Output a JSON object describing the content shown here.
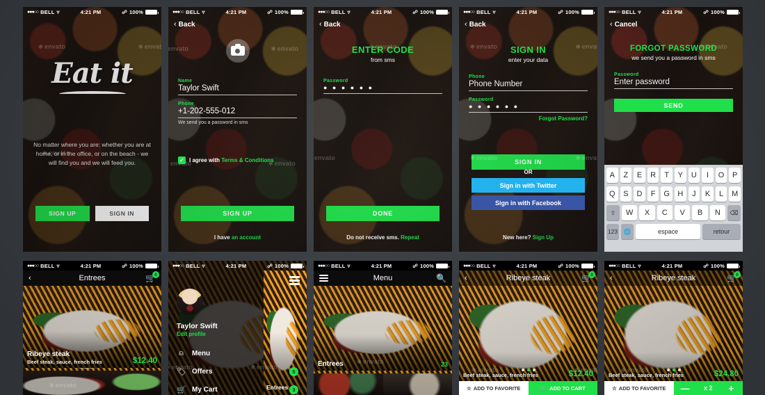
{
  "meta": {
    "background_color": "#3c4146",
    "accent_green": "#1fe04a"
  },
  "statusbar": {
    "carrier": "BELL",
    "dots": "●●●○○",
    "wifi_icon": "wifi-icon",
    "time": "4:21 PM",
    "bluetooth_icon": "bluetooth-icon",
    "battery": "100%"
  },
  "screens": {
    "welcome": {
      "logo": "Eat it",
      "tagline": "No matter where you are: whether you are at home, or in the office, or on the beach - we will find you and we will feed you.",
      "sign_up": "SIGN UP",
      "sign_in": "SIGN IN",
      "watermark": "envato"
    },
    "signup": {
      "back": "Back",
      "camera_icon": "camera-icon",
      "name_label": "Name",
      "name_value": "Taylor Swift",
      "phone_label": "Phone",
      "phone_value": "+1-202-555-012",
      "sms_hint": "We send you a password in sms",
      "agree_prefix": "I agree with ",
      "agree_link": "Terms & Conditions",
      "checkbox_icon": "check-icon",
      "submit": "SIGN UP",
      "footer_prefix": "I have ",
      "footer_link": "an account",
      "watermark": "envato"
    },
    "enter_code": {
      "back": "Back",
      "title": "ENTER CODE",
      "subtitle": "from sms",
      "password_label": "Password",
      "password_value": "● ● ● ● ● ●",
      "submit": "DONE",
      "footer_prefix": "Do not receive sms. ",
      "footer_link": "Repeat",
      "watermark": "envato"
    },
    "signin": {
      "back": "Back",
      "title": "SIGN IN",
      "subtitle": "enter your data",
      "phone_label": "Phone",
      "phone_placeholder": "Phone Number",
      "password_label": "Password",
      "password_value": "● ● ● ● ● ●",
      "forgot": "Forgot Password?",
      "submit": "SIGN IN",
      "or": "OR",
      "twitter": "Sign in with Twitter",
      "facebook": "Sign in with Facebook",
      "footer_prefix": "New here? ",
      "footer_link": "Sign Up",
      "watermark": "envato"
    },
    "forgot_password": {
      "cancel": "Cancel",
      "title": "FORGOT PASSWORD",
      "subtitle": "we send you a password in sms",
      "password_label": "Password",
      "password_placeholder": "Enter password",
      "submit": "SEND",
      "watermark": "envato",
      "keyboard": {
        "layout": "AZERTY",
        "row1": [
          "A",
          "Z",
          "E",
          "R",
          "T",
          "Y",
          "U",
          "I",
          "O",
          "P"
        ],
        "row2": [
          "Q",
          "S",
          "D",
          "F",
          "G",
          "H",
          "J",
          "K",
          "L",
          "M"
        ],
        "row3_letters": [
          "W",
          "X",
          "C",
          "V",
          "B",
          "N"
        ],
        "shift_icon": "shift-icon",
        "backspace_icon": "backspace-icon",
        "numeric": "123",
        "globe_icon": "globe-icon",
        "space": "espace",
        "return": "retour"
      }
    },
    "entrees": {
      "back_icon": "chevron-left-icon",
      "title": "Entrees",
      "cart_icon": "cart-icon",
      "cart_badge": "0",
      "item": {
        "name": "Ribeye steak",
        "desc": "Beef steak, sauce, french fries",
        "price": "$12.40"
      },
      "watermark": "envato"
    },
    "drawer": {
      "hamburger_icon": "hamburger-icon",
      "avatar": "avatar",
      "user_name": "Taylor Swift",
      "edit_profile": "Edit profile",
      "items": [
        {
          "label": "Menu",
          "icon": "dish-cover-icon",
          "badge": ""
        },
        {
          "label": "Offers",
          "icon": "tag-icon",
          "badge": "5"
        },
        {
          "label": "My Cart",
          "icon": "cart-icon",
          "badge": "3"
        }
      ],
      "peek_label": "Entrees",
      "watermark": "envato"
    },
    "menu": {
      "hamburger_icon": "hamburger-icon",
      "title": "Menu",
      "search_icon": "search-icon",
      "category": {
        "name": "Entrees",
        "count": "23"
      },
      "watermark": "envato"
    },
    "detail": {
      "back_icon": "chevron-left-icon",
      "title": "Ribeye steak",
      "cart_icon": "cart-icon",
      "cart_badge": "0",
      "desc": "Beef steak, sauce, french fries",
      "price": "$12.40",
      "favorite": "ADD TO FAVORITE",
      "favorite_icon": "star-icon",
      "add_to_cart": "ADD TO CART",
      "add_to_cart_icon": "cart-icon",
      "watermark": "envato"
    },
    "detail_qty": {
      "back_icon": "chevron-left-icon",
      "title": "Ribeye steak",
      "cart_icon": "cart-icon",
      "cart_badge": "0",
      "desc": "Beef steak, sauce, french fries",
      "price": "$24.80",
      "favorite": "ADD TO FAVORITE",
      "favorite_icon": "star-icon",
      "minus": "—",
      "quantity": "x 2",
      "plus": "+",
      "watermark": "envato"
    }
  }
}
